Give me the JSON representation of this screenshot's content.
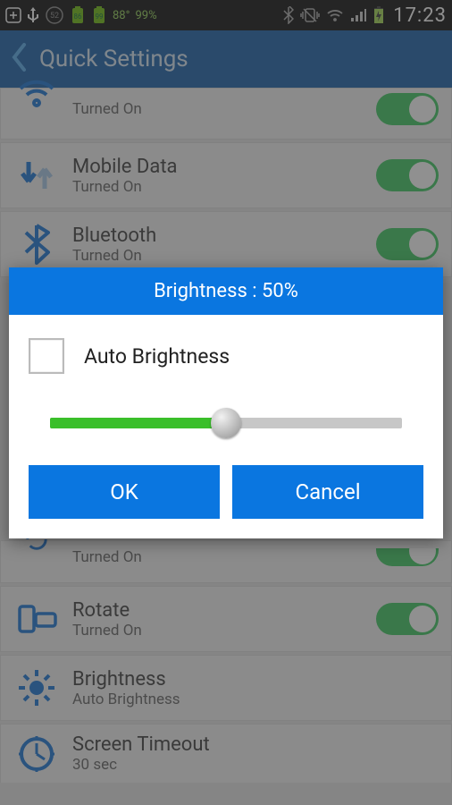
{
  "status": {
    "battery_pct_1": "88°",
    "battery_pct_2": "99%",
    "time": "17:23"
  },
  "header": {
    "title": "Quick Settings"
  },
  "rows": {
    "wifi": {
      "title": "",
      "subtitle": "Turned On"
    },
    "mobile": {
      "title": "Mobile Data",
      "subtitle": "Turned On"
    },
    "bt": {
      "title": "Bluetooth",
      "subtitle": "Turned On"
    },
    "unknown": {
      "title": "",
      "subtitle": "Turned On"
    },
    "rotate": {
      "title": "Rotate",
      "subtitle": "Turned On"
    },
    "brightness": {
      "title": "Brightness",
      "subtitle": "Auto Brightness"
    },
    "timeout": {
      "title": "Screen Timeout",
      "subtitle": "30 sec"
    }
  },
  "dialog": {
    "title": "Brightness : 50%",
    "auto_label": "Auto Brightness",
    "ok": "OK",
    "cancel": "Cancel",
    "slider_percent": 50
  }
}
